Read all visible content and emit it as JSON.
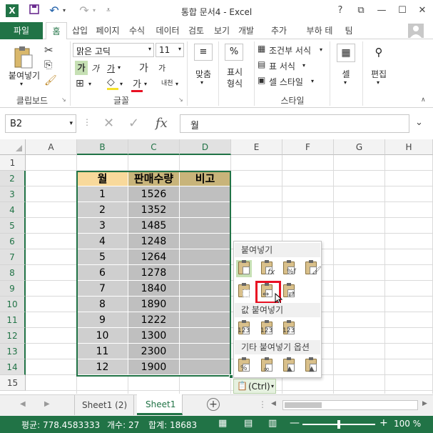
{
  "title": "통합 문서4 - Excel",
  "window": {
    "help": "?",
    "restore": "⧉",
    "minimize": "—",
    "maximize": "☐",
    "close": "✕"
  },
  "tabs": [
    "파일",
    "홈",
    "삽입",
    "페이지",
    "수식",
    "데이터",
    "검토",
    "보기",
    "개발",
    "추가",
    "부하 테",
    "팀"
  ],
  "ribbon": {
    "paste_label": "붙여넣기",
    "clipboard_group": "클립보드",
    "font_name": "맑은 고딕",
    "font_size": "11",
    "font_group": "글꼴",
    "bold": "가",
    "italic": "가",
    "underline": "가",
    "grow": "가",
    "shrink": "가",
    "font_color_glyph": "가",
    "phonetic": "내천",
    "align_label": "맞춤",
    "number_label": "표시 형식",
    "cond_format": "조건부 서식",
    "table_format": "표 서식",
    "cell_style": "셀 스타일",
    "style_group": "스타일",
    "cells_label": "셀",
    "edit_label": "편집"
  },
  "formula_bar": {
    "name_box": "B2",
    "fx": "fx",
    "value": "월"
  },
  "columns": [
    "A",
    "B",
    "C",
    "D",
    "E",
    "F",
    "G",
    "H"
  ],
  "rows": [
    "1",
    "2",
    "3",
    "4",
    "5",
    "6",
    "7",
    "8",
    "9",
    "10",
    "11",
    "12",
    "13",
    "14",
    "15"
  ],
  "table": {
    "headers": [
      "월",
      "판매수량",
      "비고"
    ],
    "rows": [
      [
        "1",
        "1526",
        ""
      ],
      [
        "2",
        "1352",
        ""
      ],
      [
        "3",
        "1485",
        ""
      ],
      [
        "4",
        "1248",
        ""
      ],
      [
        "5",
        "1264",
        ""
      ],
      [
        "6",
        "1278",
        ""
      ],
      [
        "7",
        "1840",
        ""
      ],
      [
        "8",
        "1890",
        ""
      ],
      [
        "9",
        "1222",
        ""
      ],
      [
        "10",
        "1300",
        ""
      ],
      [
        "11",
        "2300",
        ""
      ],
      [
        "12",
        "1900",
        ""
      ]
    ]
  },
  "paste_popup": {
    "section1": "붙여넣기",
    "section2": "값 붙여넣기",
    "section3": "기타 붙여넣기 옵션",
    "value_tag": "123",
    "ctrl_button": "(Ctrl)"
  },
  "sheets": [
    "Sheet1 (2)",
    "Sheet1"
  ],
  "active_sheet": "Sheet1",
  "status": {
    "average": "평균: 778.4583333",
    "count": "개수: 27",
    "sum": "합계: 18683",
    "zoom": "100 %"
  },
  "colors": {
    "brand": "#217346",
    "header_fill": "#f8d99b",
    "selection_fill": "#cfcfcf",
    "highlight_box": "#e81123"
  }
}
